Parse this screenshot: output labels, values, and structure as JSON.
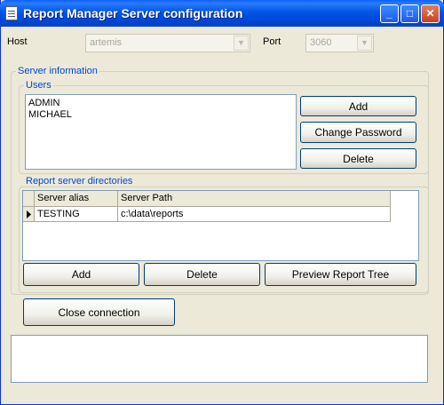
{
  "window": {
    "title": "Report Manager Server configuration"
  },
  "titlebar_buttons": {
    "minimize": "_",
    "maximize": "□",
    "close": "✕"
  },
  "connection": {
    "host_label": "Host",
    "host_value": "artemis",
    "port_label": "Port",
    "port_value": "3060"
  },
  "server_information": {
    "title": "Server information",
    "users": {
      "title": "Users",
      "items": [
        "ADMIN",
        "MICHAEL"
      ],
      "add_label": "Add",
      "change_password_label": "Change Password",
      "delete_label": "Delete"
    },
    "directories": {
      "title": "Report server directories",
      "columns": [
        "Server alias",
        "Server Path"
      ],
      "rows": [
        {
          "alias": "TESTING",
          "path": "c:\\data\\reports"
        }
      ],
      "add_label": "Add",
      "delete_label": "Delete",
      "preview_label": "Preview Report Tree"
    }
  },
  "close_connection_label": "Close connection",
  "status_text": ""
}
